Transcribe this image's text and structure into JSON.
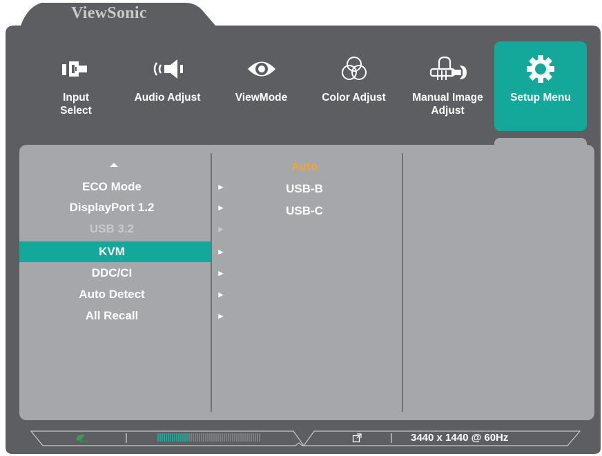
{
  "brand": "ViewSonic",
  "colors": {
    "accent": "#14a89a",
    "highlight": "#f5a623",
    "frame": "#5d5e61",
    "panel": "#a6a7ab"
  },
  "tabs": [
    {
      "label": "Input\nSelect",
      "icon": "input-select-icon"
    },
    {
      "label": "Audio Adjust",
      "icon": "speaker-icon"
    },
    {
      "label": "ViewMode",
      "icon": "eye-icon"
    },
    {
      "label": "Color Adjust",
      "icon": "color-circles-icon"
    },
    {
      "label": "Manual Image\nAdjust",
      "icon": "hand-wrench-icon"
    },
    {
      "label": "Setup Menu",
      "icon": "gear-icon",
      "active": true
    }
  ],
  "menu": {
    "items": [
      {
        "label": "ECO Mode",
        "arrow": "►"
      },
      {
        "label": "DisplayPort 1.2",
        "arrow": "►"
      },
      {
        "label": "USB 3.2",
        "arrow": "►",
        "disabled": true
      },
      {
        "label": "KVM",
        "arrow": "►",
        "selected": true
      },
      {
        "label": "DDC/CI",
        "arrow": "►"
      },
      {
        "label": "Auto Detect",
        "arrow": "►"
      },
      {
        "label": "All Recall",
        "arrow": "►"
      }
    ]
  },
  "submenu": {
    "options": [
      {
        "label": "Auto",
        "current": true
      },
      {
        "label": "USB-B"
      },
      {
        "label": "USB-C"
      }
    ]
  },
  "status": {
    "eco_icon": "eco-leaf-icon",
    "separator": "|",
    "brightness_level": 0.3,
    "link_icon": "external-link-icon",
    "resolution": "3440 x 1440 @ 60Hz"
  }
}
